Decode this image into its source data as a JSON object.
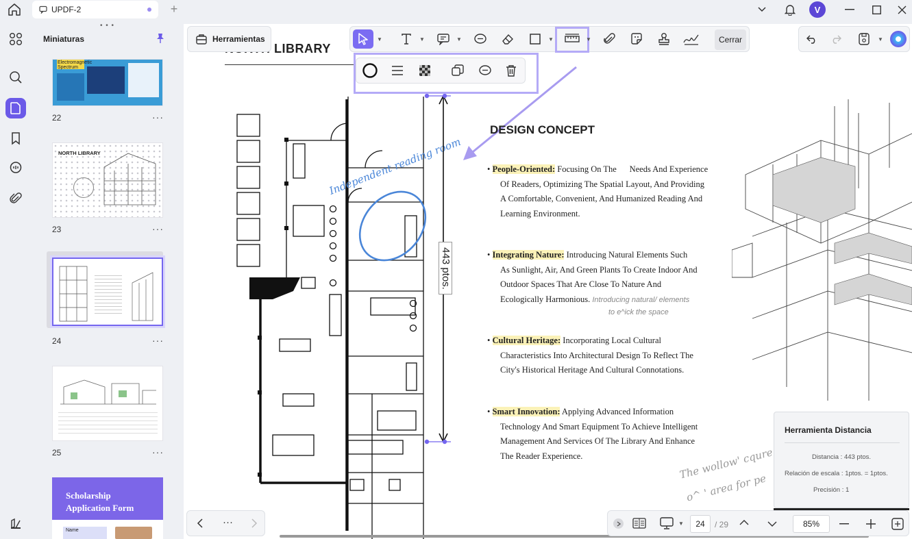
{
  "window": {
    "tab_title": "UPDF-2",
    "avatar_letter": "V"
  },
  "sidebar": {
    "panel_title": "Miniaturas",
    "pages": [
      {
        "num": "22",
        "more": "···"
      },
      {
        "num": "23",
        "more": "···"
      },
      {
        "num": "24",
        "more": "···"
      },
      {
        "num": "25",
        "more": "···"
      }
    ],
    "thumb_texts": {
      "p22_title": "Electromagnetic Spectrum",
      "p23_title": "NORTH LIBRARY",
      "p26_title": "Scholarship Application Form",
      "p26_field": "Name"
    }
  },
  "toolbar": {
    "tools_label": "Herramientas",
    "close_label": "Cerrar"
  },
  "document": {
    "header": "NORTH LIBRARY",
    "section_title": "DESIGN CONCEPT",
    "bullets": [
      {
        "title": "People-Oriented:",
        "lines": [
          "Focusing On The      Needs And Experience",
          "Of Readers, Optimizing The Spatial Layout, And Providing",
          "A Comfortable, Convenient, And Humanized Reading And",
          "Learning Environment."
        ]
      },
      {
        "title": "Integrating Nature:",
        "lines": [
          "Introducing Natural Elements Such",
          "As Sunlight, Air, And Green Plants To Create Indoor And",
          "Outdoor Spaces That Are Close To Nature And",
          "Ecologically Harmonious."
        ]
      },
      {
        "title": "Cultural Heritage:",
        "lines": [
          "Incorporating Local Cultural",
          "Characteristics Into Architectural Design To Reflect The",
          "City's Historical Heritage And Cultural Connotations."
        ]
      },
      {
        "title": "Smart Innovation:",
        "lines": [
          "Applying Advanced Information",
          "Technology And Smart Equipment To Achieve Intelligent",
          "Management And Services Of The Library And Enhance",
          "The Reader Experience."
        ]
      }
    ],
    "handwritten_note_1": "Introducing natural/ elements",
    "handwritten_note_2": "to e^ick the space",
    "handwritten_annotation": "Independent reading room",
    "measure_label": "443 ptos.",
    "corner_script_1": "The wollow' cqure Pr",
    "corner_script_2": "o^  ' area for pe"
  },
  "distance_panel": {
    "title": "Herramienta Distancia",
    "distance": "Distancia : 443 ptos.",
    "scale": "Relación de escala : 1ptos. = 1ptos.",
    "precision": "Precisión : 1"
  },
  "bottom": {
    "nav_dots": "···",
    "current_page": "24",
    "total_pages": "/ 29",
    "zoom": "85%"
  },
  "colors": {
    "accent": "#7466ef",
    "annotation_blue": "#4a86d8",
    "highlight": "#fbf2b8"
  }
}
